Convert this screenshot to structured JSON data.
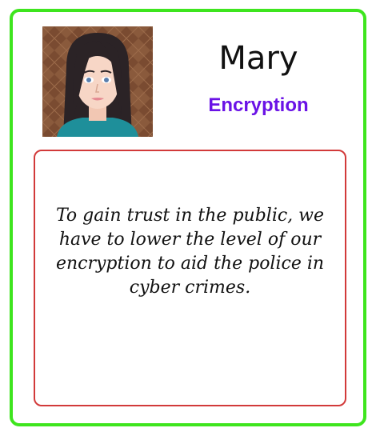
{
  "card": {
    "name": "Mary",
    "topic": "Encryption",
    "quote": "To gain trust in the public, we have to lower the level of our encryption to aid the police in cyber crimes."
  },
  "colors": {
    "card_border": "#3ee51e",
    "quote_border": "#d23a3a",
    "topic_text": "#6a12e6"
  },
  "avatar": {
    "icon": "woman-portrait-icon"
  }
}
